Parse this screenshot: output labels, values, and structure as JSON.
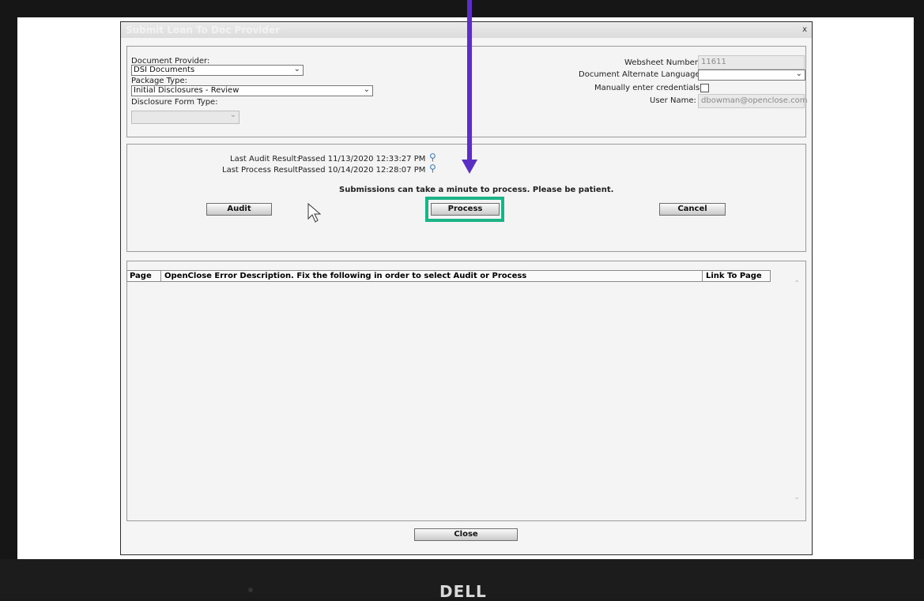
{
  "dialog": {
    "title": "Submit Loan To Doc Provider",
    "close_symbol": "x"
  },
  "settings": {
    "document_provider_label": "Document Provider:",
    "document_provider_value": "DSI Documents",
    "package_type_label": "Package Type:",
    "package_type_value": "Initial Disclosures - Review",
    "disclosure_form_type_label": "Disclosure Form Type:",
    "disclosure_form_type_value": "",
    "websheet_number_label": "Websheet Number:",
    "websheet_number_value": "11611",
    "alt_language_label": "Document Alternate Language:",
    "alt_language_value": "",
    "manual_credentials_label": "Manually enter credentials?",
    "manual_credentials_checked": false,
    "user_name_label": "User Name:",
    "user_name_value": "dbowman@openclose.com"
  },
  "status": {
    "last_audit_label": "Last Audit Result:",
    "last_audit_value": "Passed 11/13/2020 12:33:27 PM",
    "last_process_label": "Last Process Result:",
    "last_process_value": "Passed 10/14/2020 12:28:07 PM",
    "notice": "Submissions can take a minute to process. Please be patient.",
    "audit_button": "Audit",
    "process_button": "Process",
    "cancel_button": "Cancel"
  },
  "errors_table": {
    "columns": [
      "Page",
      "OpenClose Error Description. Fix the following in order to select Audit or Process",
      "Link To Page"
    ],
    "rows": []
  },
  "footer": {
    "close_button": "Close"
  },
  "device": {
    "brand": "DELL"
  },
  "colors": {
    "annotation_arrow": "#5a2fc2",
    "highlight_box": "#1cb386"
  }
}
